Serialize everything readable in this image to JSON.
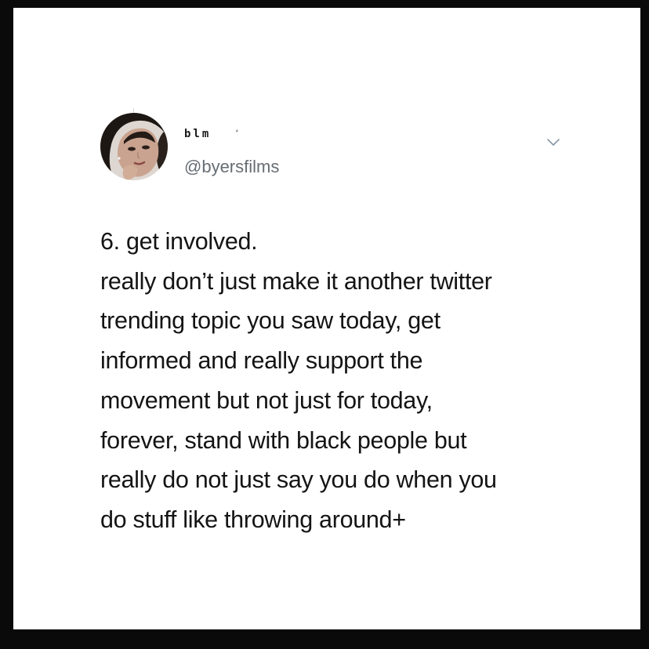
{
  "tweet": {
    "author": {
      "display_name": "blm",
      "display_name_mark": "⸗",
      "handle": "@byersfilms",
      "avatar": "profile-photo-icon"
    },
    "menu_icon": "chevron-down-icon",
    "text_lines": [
      "6. get involved.",
      "really don’t just make it another twitter",
      "trending topic you saw today, get",
      "informed and really support the",
      "movement but not just for today,",
      "forever, stand with black people but",
      "really do not just say you do when you",
      "do stuff like throwing around+"
    ]
  },
  "colors": {
    "frame_border": "#0a0a0a",
    "background": "#ffffff",
    "text": "#141414",
    "handle": "#666d73",
    "chevron": "#8899a6"
  }
}
